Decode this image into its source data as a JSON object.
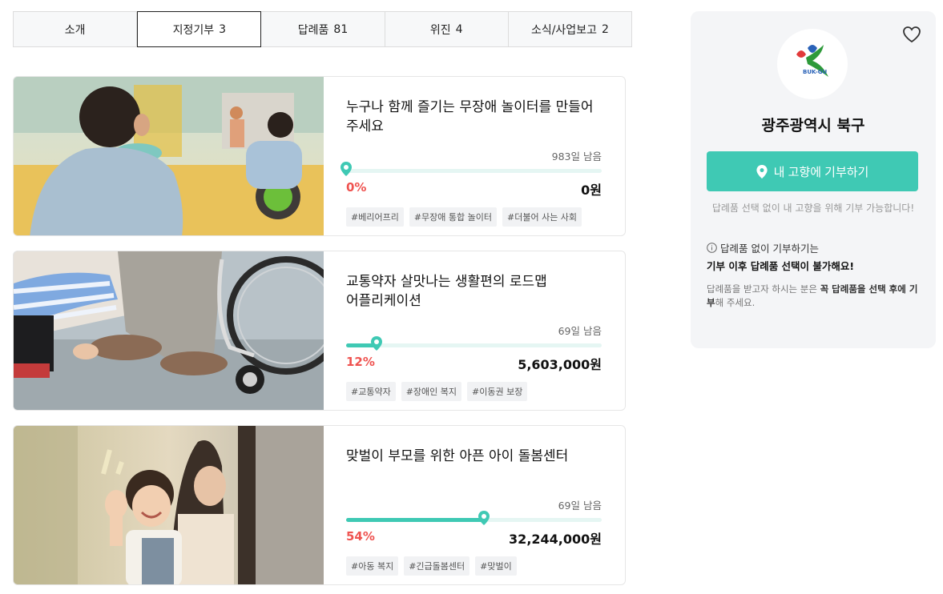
{
  "tabs": [
    {
      "label": "소개",
      "count": ""
    },
    {
      "label": "지정기부",
      "count": "3"
    },
    {
      "label": "답례품",
      "count": "81"
    },
    {
      "label": "위진",
      "count": "4"
    },
    {
      "label": "소식/사업보고",
      "count": "2"
    }
  ],
  "projects": [
    {
      "title": "누구나 함께 즐기는 무장애 놀이터를 만들어 주세요",
      "days_left": "983일 남음",
      "progress": 0.0,
      "percent": "0%",
      "amount": "0원",
      "tags": [
        "#베리어프리",
        "#무장애 통합 놀이터",
        "#더불어 사는 사회"
      ]
    },
    {
      "title": "교통약자 살맛나는 생활편의 로드맵 어플리케이션",
      "days_left": "69일 남음",
      "progress": 0.12,
      "percent": "12%",
      "amount": "5,603,000원",
      "tags": [
        "#교통약자",
        "#장애인 복지",
        "#이동권 보장"
      ]
    },
    {
      "title": "맞벌이 부모를 위한 아픈 아이 돌봄센터",
      "days_left": "69일 남음",
      "progress": 0.54,
      "percent": "54%",
      "amount": "32,244,000원",
      "tags": [
        "#아동 복지",
        "#긴급돌봄센터",
        "#맞벌이"
      ]
    }
  ],
  "sidebar": {
    "logo_text": "BUK-GU",
    "org_name": "광주광역시 북구",
    "donate_button": "내 고향에 기부하기",
    "donate_note": "답례품 선택 없이 내 고향을 위해 기부 가능합니다!",
    "info_title": "답례품 없이 기부하기는",
    "info_strong": "기부 이후 답례품 선택이 불가해요!",
    "info_desc_1": "답례품을 받고자 하시는 분은 ",
    "info_desc_bold": "꼭 답례품을 선택 후에 기부",
    "info_desc_2": "해 주세요."
  },
  "colors": {
    "accent": "#3fc9b4",
    "percent": "#ef5350",
    "tab_bg": "#f7f8f9",
    "sidebar_bg": "#f4f5f7"
  }
}
